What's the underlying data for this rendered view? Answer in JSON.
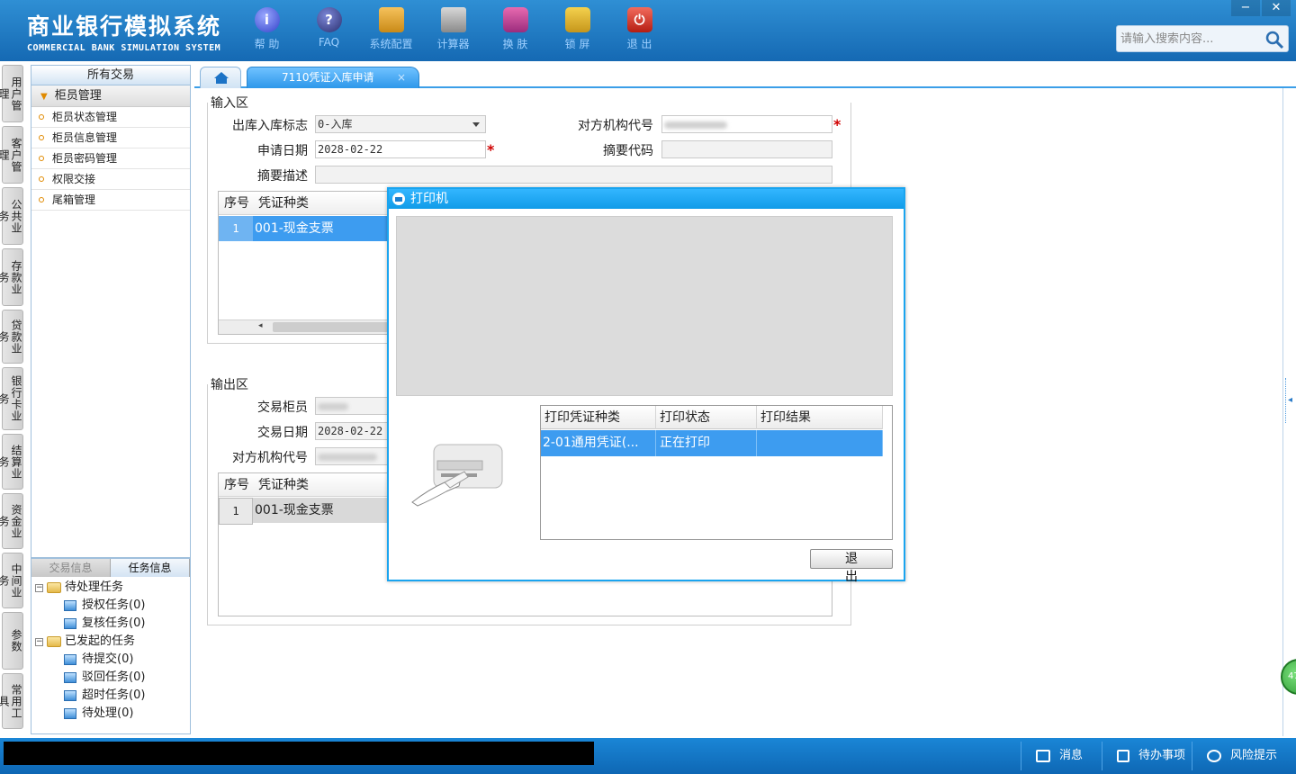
{
  "app": {
    "title_cn": "商业银行模拟系统",
    "title_en": "COMMERCIAL BANK SIMULATION SYSTEM"
  },
  "toolbar": [
    {
      "label": "帮 助",
      "icon": "info-icon",
      "glyph": "i"
    },
    {
      "label": "FAQ",
      "icon": "question-icon",
      "glyph": "?"
    },
    {
      "label": "系统配置",
      "icon": "toolbox-icon",
      "glyph": ""
    },
    {
      "label": "计算器",
      "icon": "calculator-icon",
      "glyph": ""
    },
    {
      "label": "换 肤",
      "icon": "shirt-icon",
      "glyph": ""
    },
    {
      "label": "锁 屏",
      "icon": "lock-icon",
      "glyph": ""
    },
    {
      "label": "退 出",
      "icon": "power-icon",
      "glyph": "⏻"
    }
  ],
  "window_controls": {
    "minimize": "−",
    "close": "✕"
  },
  "search": {
    "placeholder": "请输入搜索内容..."
  },
  "vertical_tabs": [
    "用户管理",
    "客户管理",
    "公共业务",
    "存款业务",
    "贷款业务",
    "银行卡业务",
    "结算业务",
    "资金业务",
    "中间业务",
    "参数",
    "常用工具"
  ],
  "nav": {
    "header": "所有交易",
    "group": "柜员管理",
    "items": [
      "柜员状态管理",
      "柜员信息管理",
      "柜员密码管理",
      "权限交接",
      "尾箱管理"
    ]
  },
  "task_panel": {
    "tabs": [
      "交易信息",
      "任务信息"
    ],
    "tree": {
      "pending": "待处理任务",
      "pending_children": [
        "授权任务(0)",
        "复核任务(0)"
      ],
      "initiated": "已发起的任务",
      "initiated_children": [
        "待提交(0)",
        "驳回任务(0)",
        "超时任务(0)",
        "待处理(0)"
      ]
    }
  },
  "tabs": {
    "active": "7110凭证入库申请",
    "close": "×"
  },
  "input_area": {
    "section": "输入区",
    "labels": {
      "io_flag": "出库入库标志",
      "counter_org": "对方机构代号",
      "apply_date": "申请日期",
      "summary_code": "摘要代码",
      "summary_desc": "摘要描述"
    },
    "values": {
      "io_flag": "0-入库",
      "apply_date": "2028-02-22"
    },
    "required_mark": "*",
    "grid": {
      "headers": [
        "序号",
        "凭证种类"
      ],
      "rows": [
        {
          "num": "1",
          "type": "001-现金支票"
        }
      ]
    }
  },
  "output_area": {
    "section": "输出区",
    "labels": {
      "teller": "交易柜员",
      "date": "交易日期",
      "counter_org": "对方机构代号"
    },
    "values": {
      "date": "2028-02-22"
    },
    "grid": {
      "headers": [
        "序号",
        "凭证种类"
      ],
      "rows": [
        {
          "num": "1",
          "type": "001-现金支票"
        }
      ]
    }
  },
  "dialog": {
    "title": "打印机",
    "headers": [
      "打印凭证种类",
      "打印状态",
      "打印结果"
    ],
    "row": {
      "type": "2-01通用凭证(...",
      "status": "正在打印",
      "result": ""
    },
    "exit_button": "退 出"
  },
  "statusbar": {
    "messages": "消息",
    "todo": "待办事项",
    "risk": "风险提示"
  },
  "side_badge": "47",
  "colors": {
    "header": "#1569b3",
    "accent": "#1aa4ef",
    "selected_row": "#3d9cf0",
    "required": "#d00000"
  }
}
